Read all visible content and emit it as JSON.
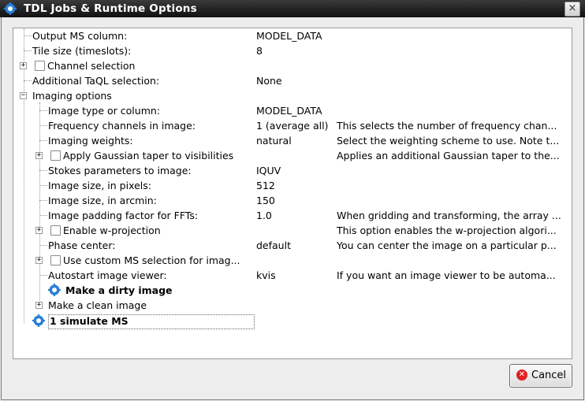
{
  "window": {
    "title": "TDL Jobs & Runtime Options",
    "close_glyph": "×",
    "app_icon": "gear-icon",
    "accent_color": "#2a7fd4"
  },
  "tree": {
    "rows": [
      {
        "label": "Output MS column:",
        "value": "MODEL_DATA",
        "description": ""
      },
      {
        "label": "Tile size (timeslots):",
        "value": "8",
        "description": ""
      },
      {
        "label": "Channel selection",
        "value": "",
        "description": "",
        "expander": "+",
        "checkbox": true
      },
      {
        "label": "Additional TaQL selection:",
        "value": "None",
        "description": ""
      },
      {
        "label": "Imaging options",
        "value": "",
        "description": "",
        "expander": "−"
      },
      {
        "label": "Image type or column:",
        "value": "MODEL_DATA",
        "description": ""
      },
      {
        "label": "Frequency channels in image:",
        "value": "1 (average all)",
        "description": "This selects the number of frequency chan..."
      },
      {
        "label": "Imaging weights:",
        "value": "natural",
        "description": "Select the weighting scheme to use. Note t..."
      },
      {
        "label": "Apply Gaussian taper to visibilities",
        "value": "",
        "description": "Applies an additional Gaussian taper to the...",
        "expander": "+",
        "checkbox": true
      },
      {
        "label": "Stokes parameters to image:",
        "value": "IQUV",
        "description": ""
      },
      {
        "label": "Image size, in pixels:",
        "value": "512",
        "description": ""
      },
      {
        "label": "Image size, in arcmin:",
        "value": "150",
        "description": ""
      },
      {
        "label": "Image padding factor for FFTs:",
        "value": "1.0",
        "description": "When gridding and transforming, the array ..."
      },
      {
        "label": "Enable w-projection",
        "value": "",
        "description": "This option enables the w-projection algori...",
        "expander": "+",
        "checkbox": true
      },
      {
        "label": "Phase center:",
        "value": "default",
        "description": "You can center the image on a particular p..."
      },
      {
        "label": "Use custom MS selection for imag...",
        "value": "",
        "description": "",
        "expander": "+",
        "checkbox": true
      },
      {
        "label": "Autostart image viewer:",
        "value": "kvis",
        "description": "If you want an image viewer to be automa..."
      },
      {
        "label": "Make a dirty image",
        "value": "",
        "description": "",
        "job": true
      },
      {
        "label": "Make a clean image",
        "value": "",
        "description": "",
        "expander": "+"
      },
      {
        "label": "1 simulate MS",
        "value": "",
        "description": "",
        "job": true
      }
    ]
  },
  "buttons": {
    "cancel_label": "Cancel",
    "cancel_icon": "cancel-icon",
    "cancel_glyph": "✕"
  }
}
